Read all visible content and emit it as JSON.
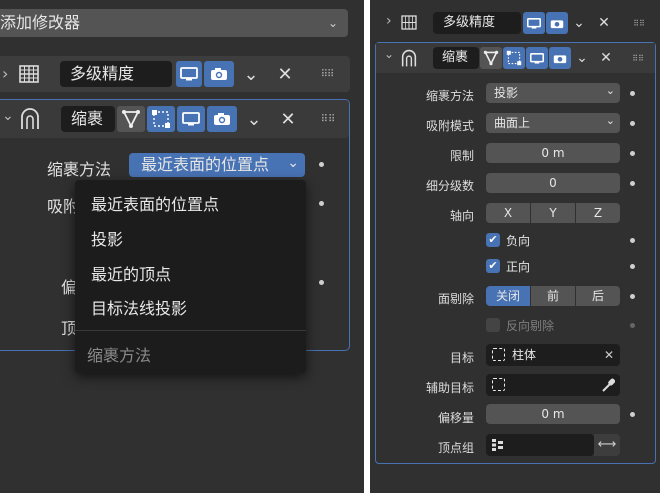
{
  "left": {
    "add_modifier": "添加修改器",
    "multires": {
      "name": "多级精度"
    },
    "shrinkwrap": {
      "name": "缩裹",
      "wrap_method_label": "缩裹方法",
      "wrap_method_value": "最近表面的位置点",
      "snap_mode_label_partial": "吸附",
      "offset_label_partial": "偏",
      "vgroup_label_partial": "顶"
    },
    "dropdown": {
      "items": [
        "最近表面的位置点",
        "投影",
        "最近的顶点",
        "目标法线投影"
      ],
      "footer": "缩裹方法"
    }
  },
  "right": {
    "multires": {
      "name": "多级精度"
    },
    "shrinkwrap": {
      "name": "缩裹",
      "wrap_method": {
        "label": "缩裹方法",
        "value": "投影"
      },
      "snap_mode": {
        "label": "吸附模式",
        "value": "曲面上"
      },
      "limit": {
        "label": "限制",
        "value": "0 m"
      },
      "subdiv": {
        "label": "细分级数",
        "value": "0"
      },
      "axis": {
        "label": "轴向",
        "x": "X",
        "y": "Y",
        "z": "Z"
      },
      "negative": "负向",
      "positive": "正向",
      "cull": {
        "label": "面剔除",
        "off": "关闭",
        "front": "前",
        "back": "后"
      },
      "invert_cull": "反向剔除",
      "target": {
        "label": "目标",
        "value": "柱体"
      },
      "aux_target": {
        "label": "辅助目标"
      },
      "offset": {
        "label": "偏移量",
        "value": "0 m"
      },
      "vgroup": {
        "label": "顶点组"
      }
    }
  },
  "colors": {
    "accent": "#4772b3",
    "panel": "#303030",
    "field": "#545454"
  }
}
